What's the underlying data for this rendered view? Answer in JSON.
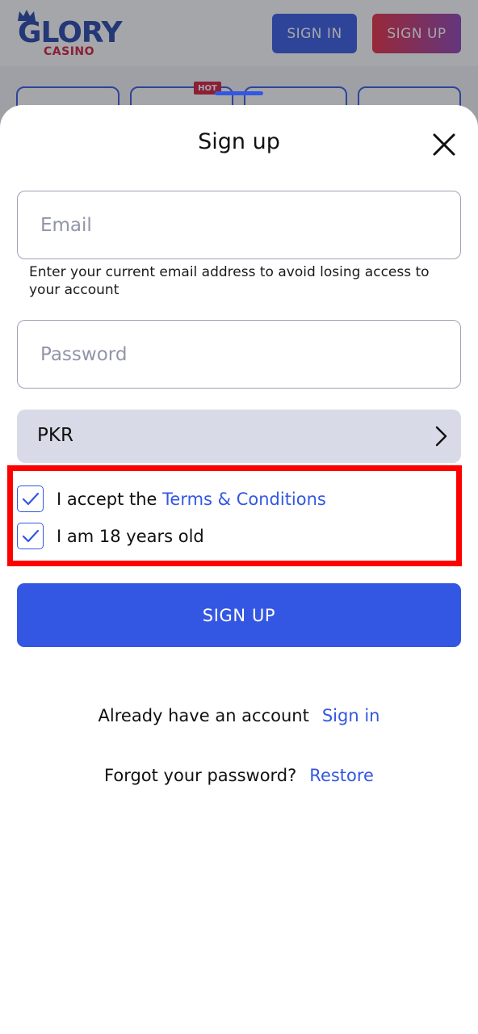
{
  "header": {
    "logo_main": "GLORY",
    "logo_sub": "CASINO",
    "signin_label": "SIGN IN",
    "signup_label": "SIGN UP",
    "hot_badge": "HOT"
  },
  "modal": {
    "title": "Sign up",
    "email": {
      "placeholder": "Email",
      "value": ""
    },
    "email_hint": "Enter your current email address to avoid losing access to your account",
    "password": {
      "placeholder": "Password",
      "value": ""
    },
    "currency": {
      "value": "PKR"
    },
    "terms": {
      "prefix": "I accept the ",
      "link": "Terms & Conditions",
      "checked": true
    },
    "age": {
      "label": "I am 18 years old",
      "checked": true
    },
    "submit_label": "SIGN UP",
    "have_account": {
      "text": "Already have an account",
      "link": "Sign in"
    },
    "forgot": {
      "text": "Forgot your password?",
      "link": "Restore"
    }
  },
  "colors": {
    "primary": "#3357e3",
    "brand_red": "#d3173a",
    "highlight": "#ff0000",
    "currency_bg": "#d8dbe7"
  },
  "icons": {
    "close": "close-icon",
    "chevron": "chevron-right-icon",
    "check": "check-icon"
  }
}
